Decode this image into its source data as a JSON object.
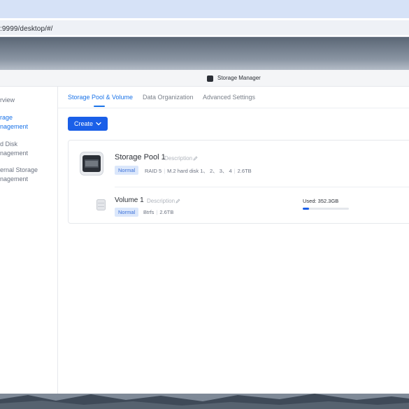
{
  "browser": {
    "url": ":9999/desktop/#/"
  },
  "window": {
    "title": "Storage Manager"
  },
  "sidebar": {
    "items": [
      {
        "lines": [
          "Overview"
        ],
        "active": false
      },
      {
        "lines": [
          "Storage",
          "Management"
        ],
        "active": true
      },
      {
        "lines": [
          "Hard Disk",
          "Management"
        ],
        "active": false
      },
      {
        "lines": [
          "External Storage",
          "Management"
        ],
        "active": false
      }
    ],
    "visible": {
      "item0_line0": "rview",
      "item1_line0": "rage",
      "item1_line1": "nagement",
      "item2_line0": "d Disk",
      "item2_line1": "nagement",
      "item3_line0": "ernal Storage",
      "item3_line1": "nagement"
    }
  },
  "tabs": [
    {
      "label": "Storage Pool & Volume",
      "active": true
    },
    {
      "label": "Data Organization",
      "active": false
    },
    {
      "label": "Advanced Settings",
      "active": false
    }
  ],
  "create_button": {
    "label": "Create"
  },
  "pool": {
    "name": "Storage Pool 1",
    "description_placeholder": "Description",
    "status": "Normal",
    "raid": "RAID 5",
    "disks": "M.2 hard disk 1、 2、 3、 4",
    "capacity": "2.6TB"
  },
  "volume": {
    "name": "Volume 1",
    "description_placeholder": "Description",
    "status": "Normal",
    "filesystem": "Btrfs",
    "capacity": "2.6TB",
    "used_label": "Used: 352.3GB",
    "used_fraction": 0.13
  },
  "colors": {
    "accent": "#1a73e8",
    "button": "#1a5fe8",
    "badge_bg": "#dbe7fb"
  },
  "icons": [
    "chevron-down-icon",
    "pencil-icon",
    "storage-pool-icon",
    "volume-icon",
    "app-icon"
  ]
}
